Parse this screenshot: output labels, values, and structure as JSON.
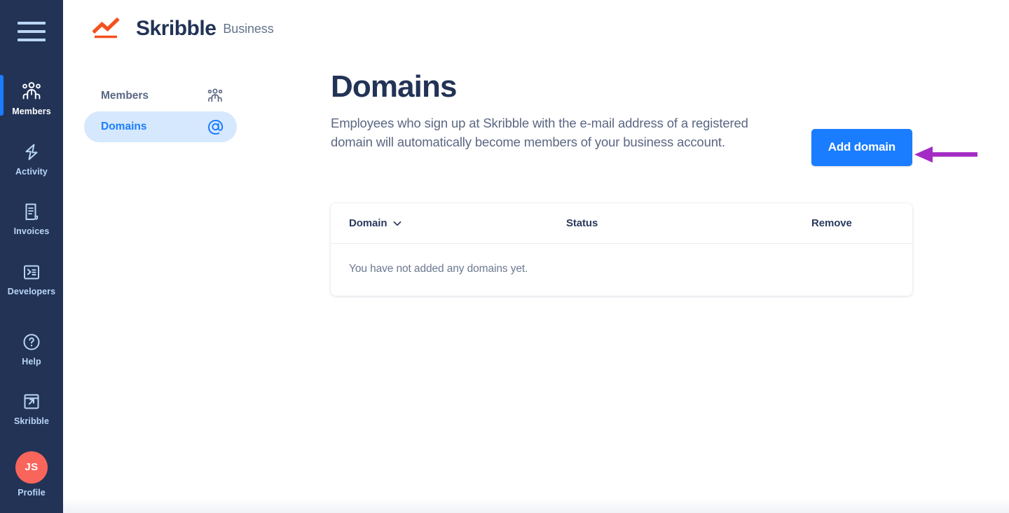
{
  "brand": {
    "name": "Skribble",
    "suffix": "Business",
    "logo_icon": "skribble-chart-logo",
    "accent_color": "#f4511e",
    "text_color": "#223356"
  },
  "colors": {
    "rail_bg": "#223356",
    "accent_blue": "#1a7dff",
    "active_pill_bg": "#d6e8fd",
    "muted_text": "#5a6782",
    "avatar_bg": "#f9655b",
    "annotation_arrow": "#a32bc4"
  },
  "rail": {
    "menu_button": {
      "label": "Menu",
      "icon": "hamburger-icon"
    },
    "items": [
      {
        "label": "Members",
        "icon": "people-group-icon",
        "active": true
      },
      {
        "label": "Activity",
        "icon": "lightning-bolt-icon",
        "active": false
      },
      {
        "label": "Invoices",
        "icon": "document-lines-icon",
        "active": false
      },
      {
        "label": "Developers",
        "icon": "terminal-icon",
        "active": false
      }
    ],
    "bottom_items": [
      {
        "label": "Help",
        "icon": "question-circle-icon",
        "active": false
      },
      {
        "label": "Skribble",
        "icon": "external-link-icon",
        "active": false
      },
      {
        "label": "Profile",
        "icon": "avatar-icon",
        "initials": "JS",
        "active": false
      }
    ]
  },
  "subnav": {
    "items": [
      {
        "label": "Members",
        "icon": "people-group-icon",
        "active": false
      },
      {
        "label": "Domains",
        "icon": "at-sign-icon",
        "active": true
      }
    ]
  },
  "page": {
    "title": "Domains",
    "description": "Employees who sign up at Skribble with the e-mail address of a registered domain will automatically become members of your business account.",
    "add_domain_label": "Add domain"
  },
  "table": {
    "columns": [
      {
        "key": "domain",
        "label": "Domain",
        "sortable": true,
        "sort_icon": "chevron-down-icon"
      },
      {
        "key": "status",
        "label": "Status",
        "sortable": false
      },
      {
        "key": "remove",
        "label": "Remove",
        "sortable": false
      }
    ],
    "rows": [],
    "empty_message": "You have not added any domains yet."
  },
  "annotation": {
    "type": "arrow",
    "points_to": "add-domain-button",
    "color": "#a32bc4"
  }
}
